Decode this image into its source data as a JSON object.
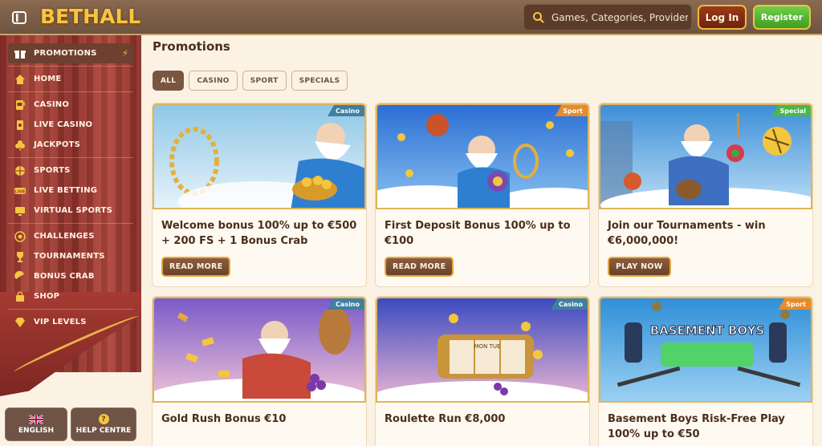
{
  "header": {
    "logo": "BETHALL",
    "search_placeholder": "Games, Categories, Providers",
    "login_label": "Log In",
    "register_label": "Register"
  },
  "sidebar": {
    "items": [
      {
        "label": "PROMOTIONS",
        "icon": "gift-icon"
      },
      {
        "label": "HOME",
        "icon": "home-icon"
      },
      {
        "label": "CASINO",
        "icon": "slot-machine-icon"
      },
      {
        "label": "LIVE CASINO",
        "icon": "card-icon"
      },
      {
        "label": "JACKPOTS",
        "icon": "clover-icon"
      },
      {
        "label": "SPORTS",
        "icon": "basketball-icon"
      },
      {
        "label": "LIVE BETTING",
        "icon": "live-icon"
      },
      {
        "label": "VIRTUAL SPORTS",
        "icon": "monitor-icon"
      },
      {
        "label": "CHALLENGES",
        "icon": "target-icon"
      },
      {
        "label": "TOURNAMENTS",
        "icon": "trophy-icon"
      },
      {
        "label": "BONUS CRAB",
        "icon": "crab-icon"
      },
      {
        "label": "SHOP",
        "icon": "bag-icon"
      },
      {
        "label": "VIP LEVELS",
        "icon": "diamond-icon"
      }
    ],
    "language_label": "ENGLISH",
    "help_label": "HELP CENTRE"
  },
  "main": {
    "title": "Promotions",
    "filters": [
      "ALL",
      "CASINO",
      "SPORT",
      "SPECIALS"
    ],
    "cards": [
      {
        "tag": "Casino",
        "title": "Welcome bonus 100% up to €500 + 200 FS + 1 Bonus Crab",
        "button": "READ MORE"
      },
      {
        "tag": "Sport",
        "title": "First Deposit Bonus 100% up to €100",
        "button": "READ MORE"
      },
      {
        "tag": "Special",
        "title": "Join our Tournaments - win €6,000,000!",
        "button": "PLAY NOW"
      },
      {
        "tag": "Casino",
        "title": "Gold Rush Bonus €10",
        "button": ""
      },
      {
        "tag": "Casino",
        "title": "Roulette Run €8,000",
        "button": ""
      },
      {
        "tag": "Sport",
        "title": "Basement Boys Risk-Free Play 100% up to €50",
        "button": ""
      }
    ],
    "banner_text": {
      "basement_boys": "BASEMENT BOYS",
      "slot_reel": "MON TUE"
    }
  },
  "colors": {
    "header_bg": "#7a5e48",
    "logo_gold": "#f6c543",
    "register_green": "#4fb32e",
    "login_red": "#8a3016",
    "sidebar_red": "#9d3a32",
    "page_bg": "#fbf2e3"
  }
}
